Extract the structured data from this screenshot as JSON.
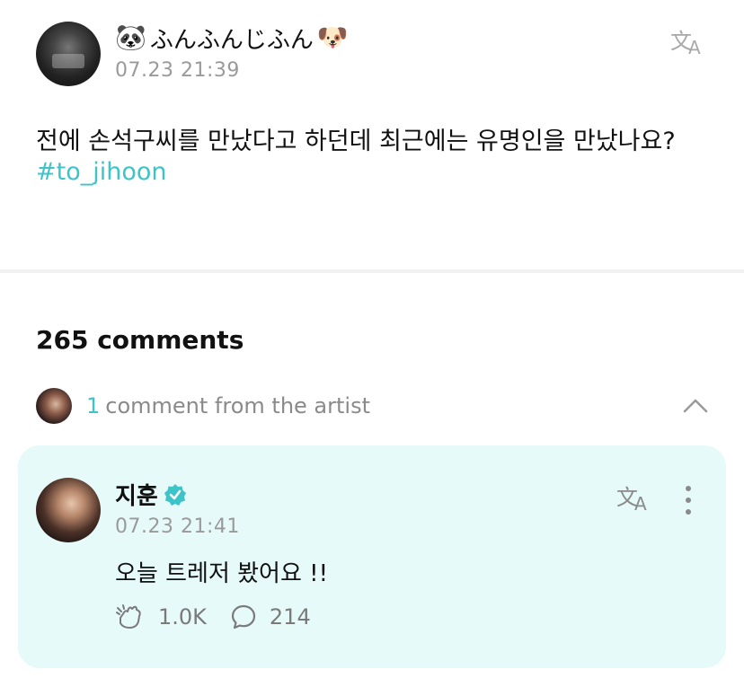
{
  "post": {
    "author_prefix_emoji": "🐼",
    "author_name": "ふんふんじふん",
    "author_suffix_emoji": "🐶",
    "time": "07.23 21:39",
    "body": "전에 손석구씨를 만났다고 하던데 최근에는 유명인을 만났나요?",
    "hashtag": "#to_jihoon",
    "translate_icon": "translate-icon"
  },
  "comments": {
    "count_label": "265 comments",
    "artist_count": "1",
    "artist_label": "comment from the artist",
    "collapse_icon": "chevron-up-icon"
  },
  "artist_comment": {
    "name": "지훈",
    "verified_icon": "verified-badge-icon",
    "time": "07.23 21:41",
    "body": "오늘 트레저 봤어요 !!",
    "likes": "1.0K",
    "replies": "214",
    "more_icon": "more-vertical-icon"
  },
  "colors": {
    "accent": "#3cc4c8",
    "card_bg": "#e6faf9",
    "muted": "#9a9a9a"
  }
}
